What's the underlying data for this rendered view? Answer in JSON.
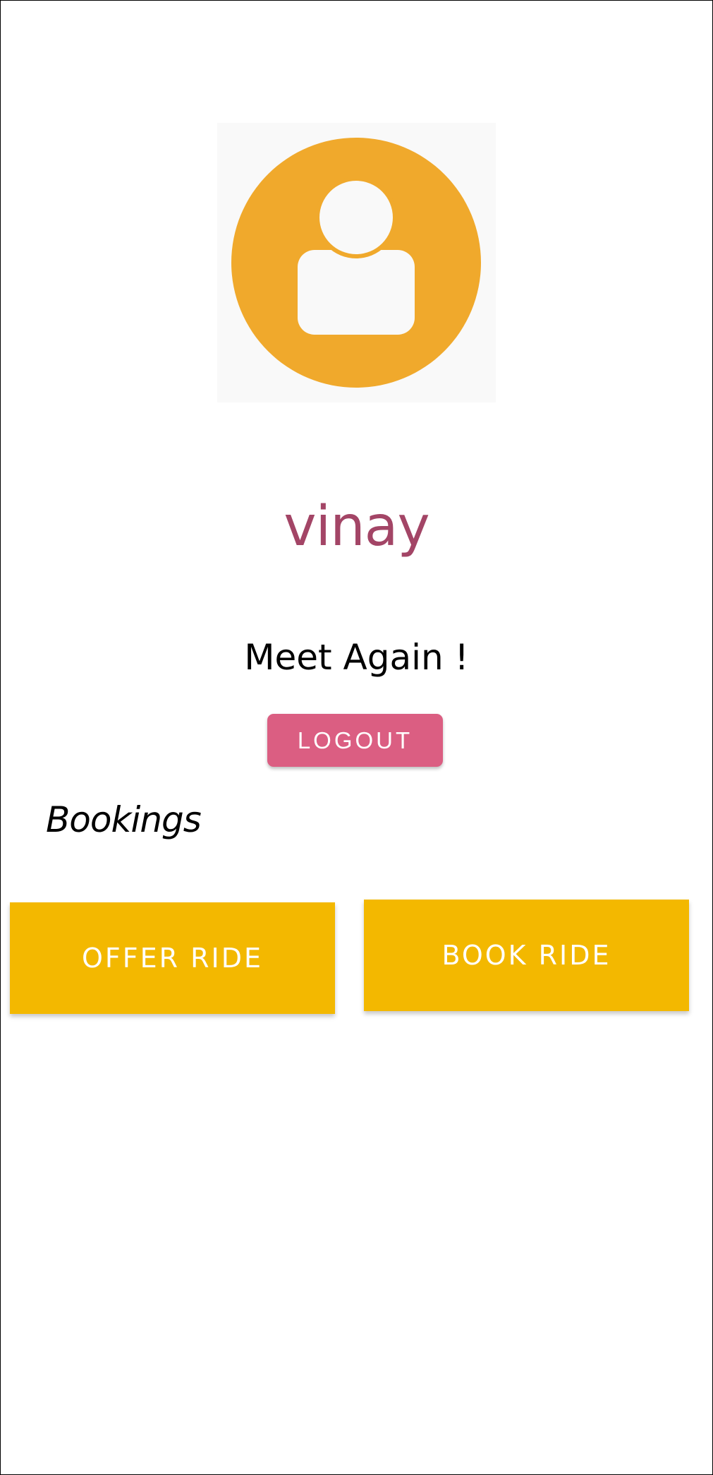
{
  "profile": {
    "name": "vinay",
    "greeting": "Meet Again !",
    "avatar_icon": "user-avatar-icon"
  },
  "actions": {
    "logout_label": "LOGOUT"
  },
  "bookings": {
    "title": "Bookings",
    "offer_ride_label": "OFFER RIDE",
    "book_ride_label": "BOOK RIDE"
  },
  "colors": {
    "avatar_circle": "#f0a92c",
    "avatar_figure": "#f9f9f9",
    "name": "#a34566",
    "logout_button": "#db5e82",
    "ride_buttons": "#f3b800"
  }
}
